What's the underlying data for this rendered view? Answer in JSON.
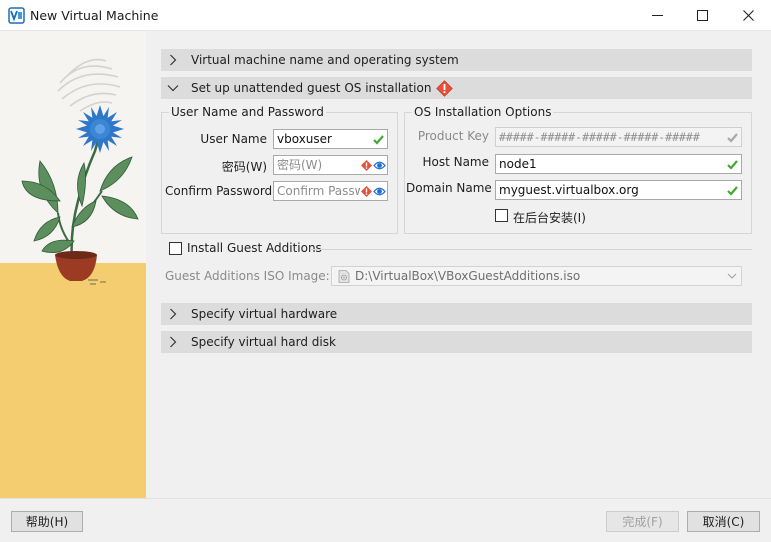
{
  "window": {
    "title": "New Virtual Machine",
    "controls": {
      "minimize": "minimize",
      "maximize": "maximize",
      "close": "close"
    }
  },
  "sections": {
    "name_os": {
      "label": "Virtual machine name and operating system",
      "expanded": false
    },
    "unattended": {
      "label": "Set up unattended guest OS installation",
      "expanded": true,
      "warning_icon": "warning-icon"
    },
    "hardware": {
      "label": "Specify virtual hardware",
      "expanded": false
    },
    "hard_disk": {
      "label": "Specify virtual hard disk",
      "expanded": false
    }
  },
  "user_group": {
    "title": "User Name and Password",
    "user_name": {
      "label": "User Name",
      "value": "vboxuser"
    },
    "password": {
      "label": "密码(W)",
      "placeholder": "密码(W)"
    },
    "confirm_password": {
      "label": "Confirm Password",
      "placeholder": "Confirm Password"
    }
  },
  "os_group": {
    "title": "OS Installation Options",
    "product_key": {
      "label": "Product Key",
      "value": "#####-#####-#####-#####-#####"
    },
    "host_name": {
      "label": "Host Name",
      "value": "node1"
    },
    "domain_name": {
      "label": "Domain Name",
      "value": "myguest.virtualbox.org"
    },
    "background_install": {
      "label": "在后台安装(I)",
      "checked": false
    }
  },
  "guest_additions": {
    "checkbox_label": "Install Guest Additions",
    "checked": false,
    "iso_label": "Guest Additions ISO Image:",
    "iso_path": "D:\\VirtualBox\\VBoxGuestAdditions.iso"
  },
  "buttons": {
    "help": "帮助(H)",
    "finish": "完成(F)",
    "cancel": "取消(C)"
  },
  "colors": {
    "section_header": "#dcdcdc",
    "valid_check": "#3faa2e",
    "warning": "#e5513a",
    "eye_icon": "#1e6ed6",
    "flower": "#2f77c9",
    "art_sand": "#f3cd6f"
  }
}
